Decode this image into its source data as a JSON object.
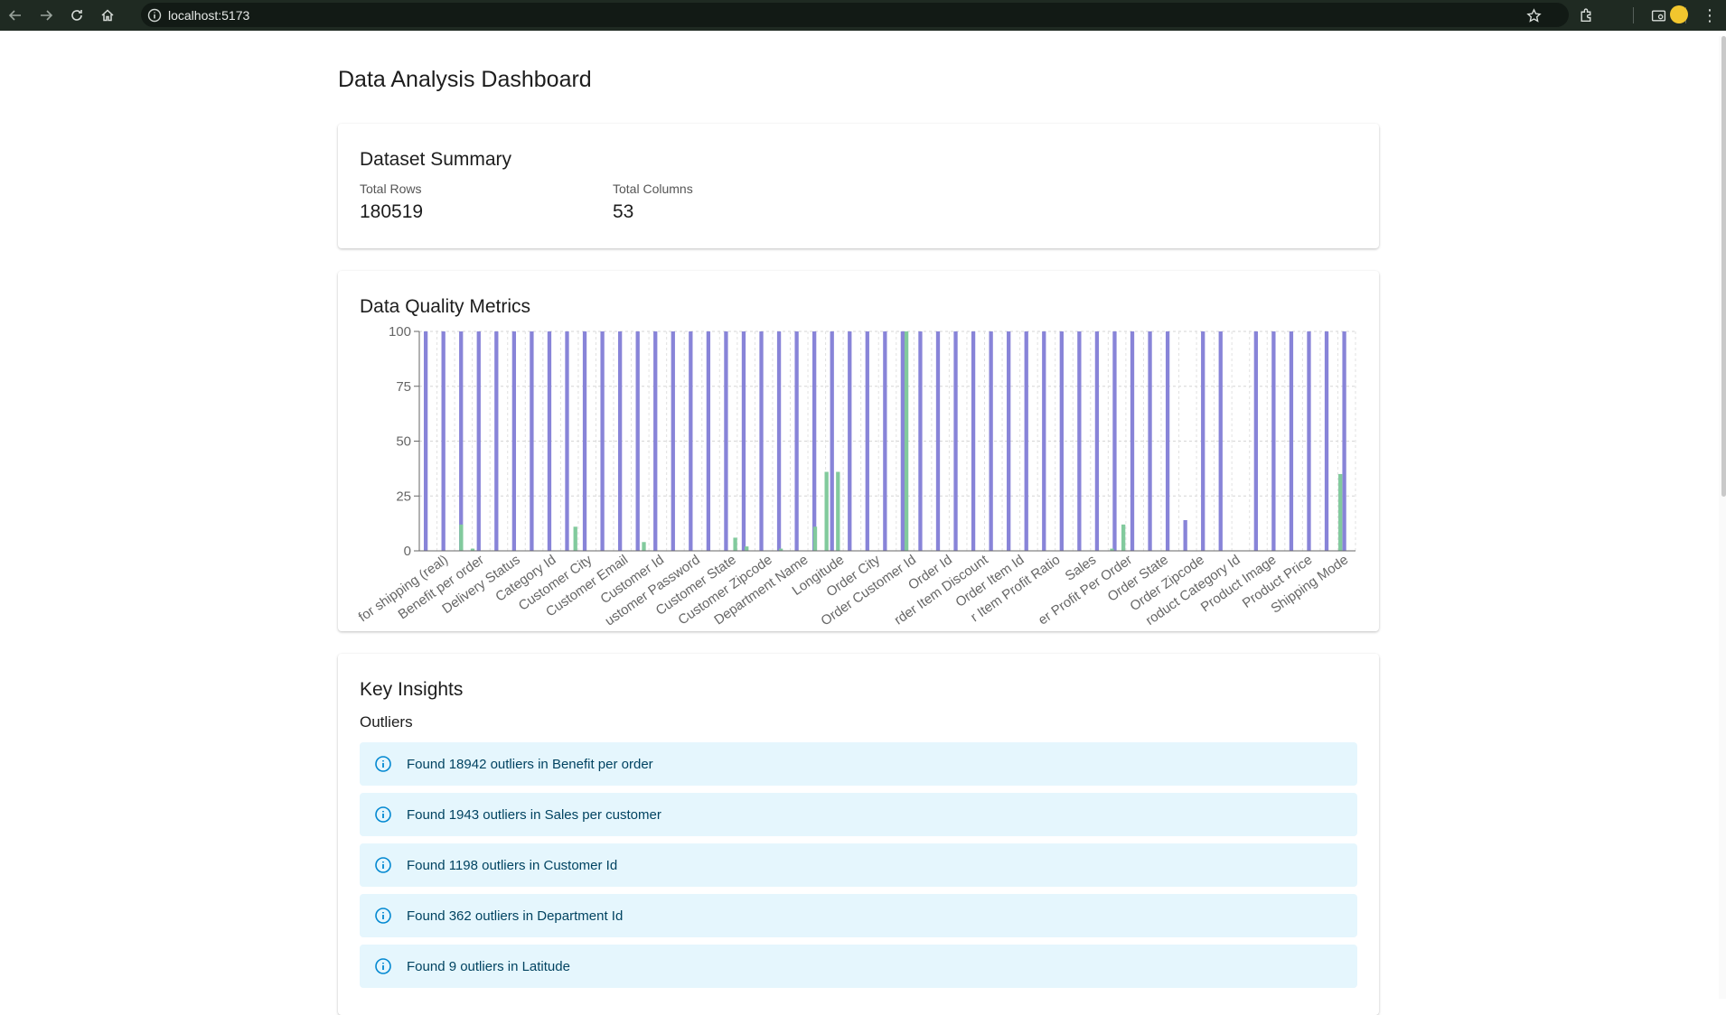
{
  "browser": {
    "url": "localhost:5173",
    "profile_color": "#f2c62e"
  },
  "page": {
    "title": "Data Analysis Dashboard"
  },
  "summary": {
    "title": "Dataset Summary",
    "total_rows_label": "Total Rows",
    "total_rows_value": "180519",
    "total_columns_label": "Total Columns",
    "total_columns_value": "53"
  },
  "quality": {
    "title": "Data Quality Metrics"
  },
  "insights": {
    "title": "Key Insights",
    "outliers_label": "Outliers",
    "alerts": [
      "Found 18942 outliers in Benefit per order",
      "Found 1943 outliers in Sales per customer",
      "Found 1198 outliers in Customer Id",
      "Found 362 outliers in Department Id",
      "Found 9 outliers in Latitude"
    ]
  },
  "chart_data": {
    "type": "bar",
    "ylim": [
      0,
      100
    ],
    "yticks": [
      0,
      25,
      50,
      75,
      100
    ],
    "grid": true,
    "colors": {
      "series_a": "#8884d8",
      "series_b": "#82ca9d"
    },
    "labels": [
      "for shipping (real)",
      "Benefit per order",
      "Delivery Status",
      "Category Id",
      "Customer City",
      "Customer Email",
      "Customer Id",
      "ustomer Password",
      "Customer State",
      "Customer Zipcode",
      "Department Name",
      "Longitude",
      "Order City",
      "Order Customer Id",
      "Order Id",
      "rder Item Discount",
      "Order Item Id",
      "r Item Profit Ratio",
      "Sales",
      "er Profit Per Order",
      "Order State",
      "Order Zipcode",
      "roduct Category Id",
      "Product Image",
      "Product Price",
      "Shipping Mode"
    ],
    "series": [
      {
        "values": [
          100,
          100,
          100,
          100,
          100,
          100,
          100,
          100,
          100,
          100,
          100,
          100,
          100,
          100,
          100,
          100,
          100,
          100,
          100,
          100,
          100,
          100,
          100,
          100,
          100,
          100,
          100,
          100,
          100,
          100,
          100,
          100,
          100,
          100,
          100,
          100,
          100,
          100,
          100,
          100,
          100,
          100,
          100,
          14,
          100,
          100,
          0,
          100,
          100,
          100,
          100,
          100,
          100
        ]
      },
      {
        "values": [
          0,
          0,
          0,
          12,
          1,
          0,
          0,
          0,
          0,
          0,
          0,
          0,
          0,
          11,
          0,
          0,
          0,
          0,
          0,
          4,
          0,
          0,
          0,
          0,
          0,
          0,
          0,
          6,
          2,
          0,
          0,
          1,
          0,
          0,
          11,
          36,
          36,
          0,
          0,
          0,
          0,
          0,
          100,
          0,
          0,
          0,
          0,
          0,
          0,
          0,
          0,
          0,
          0,
          0,
          0,
          0,
          0,
          0,
          0,
          0,
          1,
          12,
          0,
          0,
          0,
          0,
          0,
          0,
          0,
          0,
          0,
          0,
          0,
          0,
          0,
          0,
          0,
          0,
          0,
          0,
          35,
          0
        ]
      }
    ]
  }
}
